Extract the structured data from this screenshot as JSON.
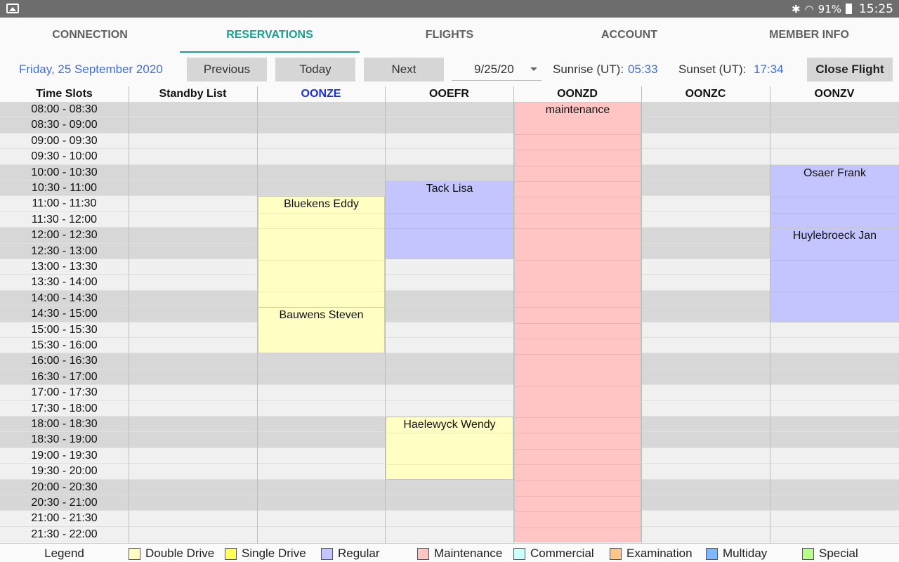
{
  "status": {
    "battery": "91%",
    "clock": "15:25"
  },
  "tabs": [
    {
      "label": "CONNECTION",
      "active": false
    },
    {
      "label": "RESERVATIONS",
      "active": true
    },
    {
      "label": "FLIGHTS",
      "active": false
    },
    {
      "label": "ACCOUNT",
      "active": false
    },
    {
      "label": "MEMBER INFO",
      "active": false
    }
  ],
  "toolbar": {
    "date_label": "Friday, 25 September 2020",
    "previous": "Previous",
    "today": "Today",
    "next": "Next",
    "date_value": "9/25/20",
    "sunrise_label": "Sunrise (UT):",
    "sunrise_value": "05:33",
    "sunset_label": "Sunset (UT):",
    "sunset_value": "17:34",
    "close_flight": "Close Flight"
  },
  "colors": {
    "accent": "#1a9e8f",
    "link_blue": "#3e6fe0",
    "double_drive": "#ffffc4",
    "single_drive": "#ffff55",
    "regular": "#c4c4ff",
    "maintenance": "#ffc4c4",
    "commercial": "#ccffff",
    "examination": "#ffc68a",
    "multiday": "#7fb8ff",
    "special": "#b8ff8a"
  },
  "grid": {
    "headers": [
      "Time Slots",
      "Standby List",
      "OONZE",
      "OOEFR",
      "OONZD",
      "OONZC",
      "OONZV"
    ],
    "selected_header": 2,
    "slots": [
      "08:00 - 08:30",
      "08:30 - 09:00",
      "09:00 - 09:30",
      "09:30 - 10:00",
      "10:00 - 10:30",
      "10:30 - 11:00",
      "11:00 - 11:30",
      "11:30 - 12:00",
      "12:00 - 12:30",
      "12:30 - 13:00",
      "13:00 - 13:30",
      "13:30 - 14:00",
      "14:00 - 14:30",
      "14:30 - 15:00",
      "15:00 - 15:30",
      "15:30 - 16:00",
      "16:00 - 16:30",
      "16:30 - 17:00",
      "17:00 - 17:30",
      "17:30 - 18:00",
      "18:00 - 18:30",
      "18:30 - 19:00",
      "19:00 - 19:30",
      "19:30 - 20:00",
      "20:00 - 20:30",
      "20:30 - 21:00",
      "21:00 - 21:30",
      "21:30 - 22:00"
    ],
    "row_shading": [
      1,
      1,
      0,
      0,
      1,
      1,
      0,
      0,
      1,
      1,
      0,
      0,
      1,
      1,
      0,
      0,
      1,
      1,
      0,
      0,
      1,
      1,
      0,
      0,
      1,
      1,
      0,
      0
    ],
    "reservations": [
      {
        "column": 2,
        "start": 6,
        "end": 16,
        "name": "Bluekens Eddy",
        "type": "double",
        "segments": [
          7,
          8,
          10,
          12
        ],
        "second_label": {
          "text": "Bauwens Steven",
          "at": 13
        }
      },
      {
        "column": 3,
        "start": 5,
        "end": 10,
        "name": "Tack Lisa",
        "type": "regular",
        "segments": [
          7,
          8
        ]
      },
      {
        "column": 3,
        "start": 20,
        "end": 24,
        "name": "Haelewyck Wendy",
        "type": "double",
        "segments": [
          21,
          23
        ]
      },
      {
        "column": 4,
        "start": 0,
        "end": 28,
        "name": "maintenance",
        "type": "maint",
        "segments": [
          2,
          3,
          4,
          5,
          6,
          7,
          8,
          10,
          12,
          13,
          14,
          15,
          16,
          18,
          20,
          21,
          22,
          23,
          24,
          25,
          26,
          27
        ]
      },
      {
        "column": 6,
        "start": 4,
        "end": 8,
        "name": "Osaer Frank",
        "type": "regular",
        "segments": [
          6,
          7
        ]
      },
      {
        "column": 6,
        "start": 8,
        "end": 14,
        "name": "Huylebroeck Jan",
        "type": "regular",
        "segments": [
          10,
          12
        ]
      }
    ]
  },
  "legend": {
    "title": "Legend",
    "items": [
      {
        "label": "Double Drive",
        "color": "#ffffc4"
      },
      {
        "label": "Single Drive",
        "color": "#ffff55"
      },
      {
        "label": "Regular",
        "color": "#c4c4ff"
      },
      {
        "label": "Maintenance",
        "color": "#ffc4c4"
      },
      {
        "label": "Commercial",
        "color": "#ccffff"
      },
      {
        "label": "Examination",
        "color": "#ffc68a"
      },
      {
        "label": "Multiday",
        "color": "#7fb8ff"
      },
      {
        "label": "Special",
        "color": "#b8ff8a"
      }
    ]
  }
}
